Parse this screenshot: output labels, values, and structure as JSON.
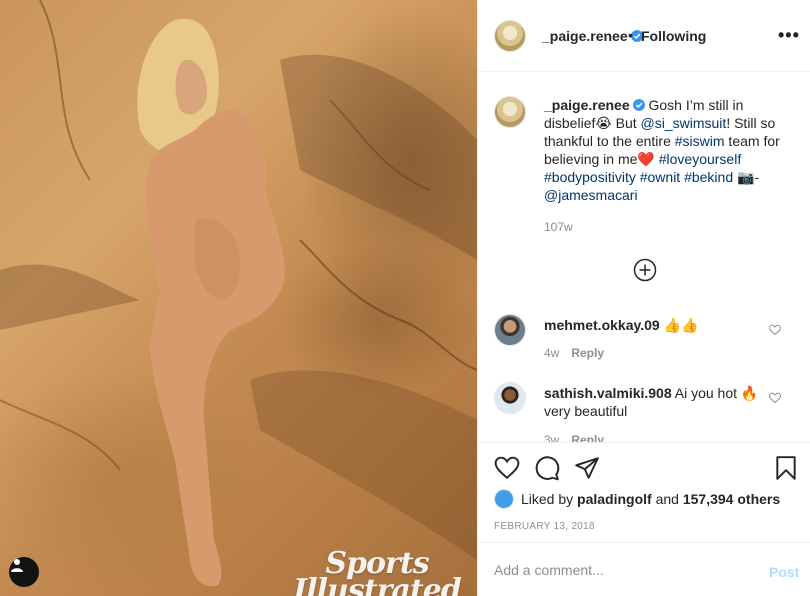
{
  "post_image": {
    "watermark_line1": "Sports",
    "watermark_line2": "Illustrated",
    "user_tag_icon": "person-icon"
  },
  "header": {
    "username": "_paige.renee",
    "separator": "•",
    "follow_state": "Following",
    "more_label": "•••",
    "verified_icon": "verified-badge-icon"
  },
  "caption": {
    "username": "_paige.renee",
    "text_1": " Gosh I’m still in disbelief😭 But ",
    "mention_1": "@si_swimsuit",
    "text_2": "! Still so thankful to the entire ",
    "tag_1": "#siswim",
    "text_3": " team for believing in me❤️ ",
    "tag_2": "#loveyourself",
    "text_4": " ",
    "tag_3": "#bodypositivity",
    "text_5": " ",
    "tag_4": "#ownit",
    "text_6": " ",
    "tag_5": "#bekind",
    "text_7": " 📷- ",
    "mention_2": "@jamesmacari",
    "time": "107w"
  },
  "comments": [
    {
      "username": "mehmet.okkay.09",
      "text": " 👍👍",
      "time": "4w",
      "reply": "Reply"
    },
    {
      "username": "sathish.valmiki.908",
      "text": " Ai you hot 🔥 very beautiful",
      "time": "3w",
      "reply": "Reply"
    }
  ],
  "likes": {
    "prefix": "Liked by ",
    "liker": "paladingolf",
    "middle": " and ",
    "count": "157,394 others"
  },
  "post_date": "FEBRUARY 13, 2018",
  "add_comment": {
    "placeholder": "Add a comment...",
    "post_label": "Post"
  },
  "colors": {
    "link_blue": "#00376b",
    "verified_blue": "#3897f0",
    "post_disabled": "#b3dbff",
    "heart_red": "#ed4956"
  }
}
